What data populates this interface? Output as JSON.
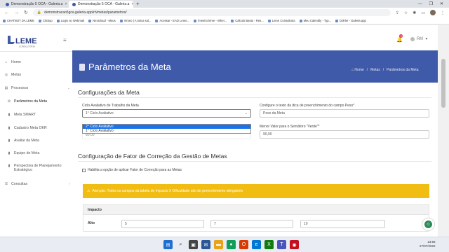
{
  "browser": {
    "tabs": [
      {
        "title": "Demonstração 5 OCA - Galeria.a",
        "active": false
      },
      {
        "title": "Demonstração 5 OCA - Galeria.a",
        "active": true
      }
    ],
    "url": "demonstracao5gca.galeria.app/rh/metas/parametros/",
    "bookmarks": [
      "CHATBOT DA LEME",
      "Clickup",
      "Login no Webmail",
      "Nextcloud - Meus",
      "Vimeo | A única sol...",
      "Acessar - EAD Leme...",
      "/meeiro.leme - Wher...",
      "Cálculo Basto - Res...",
      "Leme Consultoria",
      "Meu Calendly - Typ...",
      "Dohler - Galeria.app"
    ]
  },
  "header": {
    "logo_text": "LEME",
    "logo_sub": "CONSULTORIA",
    "notification_count": "9",
    "user_label": "Rh!"
  },
  "sidebar": {
    "items": [
      {
        "label": "Home",
        "icon": "home-icon"
      },
      {
        "label": "Metas",
        "icon": "target-icon"
      },
      {
        "label": "Processos",
        "icon": "folder-icon"
      },
      {
        "label": "Parâmetros da Meta",
        "icon": "gear-icon"
      },
      {
        "label": "Meta SMART",
        "icon": "file-icon"
      },
      {
        "label": "Cadastro Meta OKR",
        "icon": "file-icon"
      },
      {
        "label": "Avaliar da Meta",
        "icon": "file-icon"
      },
      {
        "label": "Equipe de Meta",
        "icon": "file-icon"
      },
      {
        "label": "Perspectiva de Planejamento Estratégico",
        "icon": "file-icon"
      },
      {
        "label": "Consultas",
        "icon": "list-icon"
      }
    ]
  },
  "page_header": {
    "title": "Parâmetros da Meta",
    "breadcrumb": [
      "Home",
      "Metas",
      "Parâmetros da Meta"
    ]
  },
  "config": {
    "section_title": "Configurações da Meta",
    "ciclo_label": "Ciclo Avaliativo de Trabalho da Meta",
    "ciclo_value": "1° Ciclo Avaliativo",
    "ciclo_options": [
      "2° Ciclo Avaliativo",
      "1° Ciclo Avaliativo"
    ],
    "ciclo_selected_option": "2° Ciclo Avaliativo",
    "behind_dropdown_text": "80,00",
    "peso_label": "Configure o texto da dica de preenchimento do campo Peso*",
    "peso_value": "Peso da Meta",
    "semaforo_label": "Menor Valor para o Semáforo \"Verde\"*",
    "semaforo_value": "90,00"
  },
  "fator": {
    "section_title": "Configuração de Fator de Correção da Gestão de Metas",
    "checkbox_label": "Habilita a opção de aplicar Fator de Correção para as Metas",
    "alert_text": "Atenção: Todos os campos da tabela de Impacto X Dificuldade são de preenchimento obrigatório",
    "table_header": "Impacto",
    "row_label": "Alto",
    "row_values": [
      "5",
      "7",
      "10"
    ]
  },
  "taskbar": {
    "time": "13:56",
    "date": "27/07/2022"
  }
}
